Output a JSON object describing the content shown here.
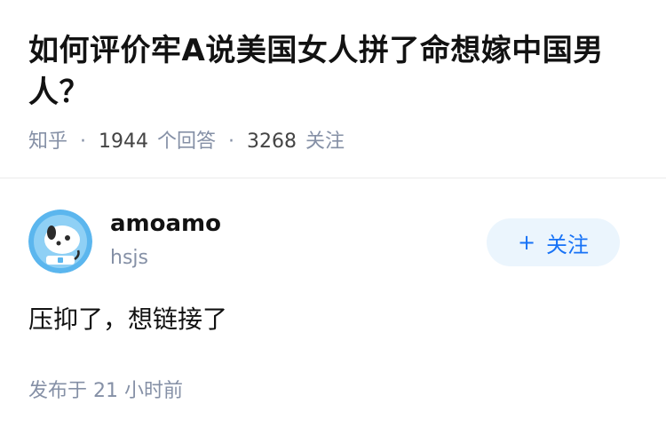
{
  "question": {
    "title": "如何评价牢A说美国女人拼了命想嫁中国男人？",
    "source": "知乎",
    "answer_count": "1944",
    "answer_label": "个回答",
    "follower_count": "3268",
    "follower_label": "关注",
    "separator": "·"
  },
  "answer": {
    "author_name": "amoamo",
    "author_headline": "hsjs",
    "follow_button_label": "关注",
    "follow_button_icon": "plus-icon",
    "content": "压抑了，想链接了",
    "publish_label": "发布于",
    "publish_time": "21 小时前"
  },
  "colors": {
    "title": "#121212",
    "meta": "#8590a6",
    "accent": "#1772f6",
    "button_bg": "#ebf5fd",
    "avatar_bg": "#5bb6ee"
  }
}
